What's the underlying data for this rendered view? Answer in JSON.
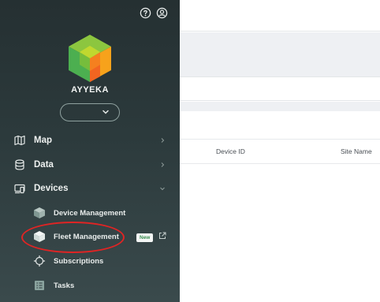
{
  "brand": {
    "name": "AYYEKA"
  },
  "header_icons": [
    "help-circle-icon",
    "user-circle-icon"
  ],
  "site_selector": {
    "value": ""
  },
  "nav": {
    "map": {
      "label": "Map",
      "icon": "map-icon"
    },
    "data": {
      "label": "Data",
      "icon": "database-icon"
    },
    "devices": {
      "label": "Devices",
      "icon": "devices-icon"
    }
  },
  "devices_sub": {
    "device_management": {
      "label": "Device Management",
      "icon": "box-icon"
    },
    "fleet_management": {
      "label": "Fleet Management",
      "icon": "box-icon",
      "badge": "New"
    },
    "subscriptions": {
      "label": "Subscriptions",
      "icon": "crosshair-icon"
    },
    "tasks": {
      "label": "Tasks",
      "icon": "list-icon"
    }
  },
  "table": {
    "columns": [
      "Device ID",
      "Site Name"
    ]
  },
  "colors": {
    "sidebar_bg": "#2a3638",
    "highlight": "#e02424",
    "badge_text": "#3a8d50"
  }
}
